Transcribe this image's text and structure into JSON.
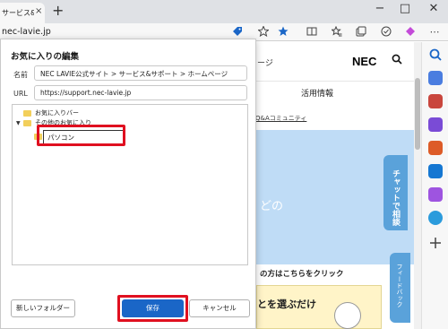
{
  "browser": {
    "tab_title": "サービス&サ",
    "tab_close": "×",
    "new_tab": "+",
    "window_controls": {
      "minimize": "−",
      "maximize": "□",
      "close": "✕"
    },
    "address_text": "nec-lavie.jp",
    "toolbar_icons": [
      "tag-icon",
      "favorite-star-icon",
      "split-screen-icon",
      "favorites-icon",
      "collections-icon",
      "extensions-icon",
      "more-icon"
    ]
  },
  "website": {
    "header_fragment": "ージ",
    "logo_text": "NEC",
    "nav_info": "活用情報",
    "qa_link": "Q&Aコミュニティ",
    "hero_fragment": "どの",
    "chat_tab": "チャットで相談",
    "banner_text": "の方はこちらをクリック",
    "card_text": "とを選ぶだけ",
    "feedback_tab": "フィードバック",
    "colors": {
      "hero": "#bfdcf6",
      "chat_tab": "#5aa2da"
    }
  },
  "sidebar": {
    "icons": [
      "search-icon",
      "shopping-icon",
      "tools-icon",
      "games-icon",
      "office-icon",
      "outlook-icon",
      "copilot-icon",
      "telegram-icon",
      "add-icon"
    ]
  },
  "dialog": {
    "title": "お気に入りの編集",
    "name_label": "名前",
    "name_value": "NEC LAVIE公式サイト > サービス&サポート > ホームページ",
    "url_label": "URL",
    "url_value": "https://support.nec-lavie.jp",
    "tree": {
      "items": [
        {
          "label": "お気に入りバー"
        },
        {
          "label": "その他のお気に入り"
        }
      ],
      "rename_value": "パソコン"
    },
    "buttons": {
      "new_folder": "新しいフォルダー",
      "save": "保存",
      "cancel": "キャンセル"
    },
    "colors": {
      "primary": "#1a66c7",
      "highlight": "#e01020"
    }
  }
}
